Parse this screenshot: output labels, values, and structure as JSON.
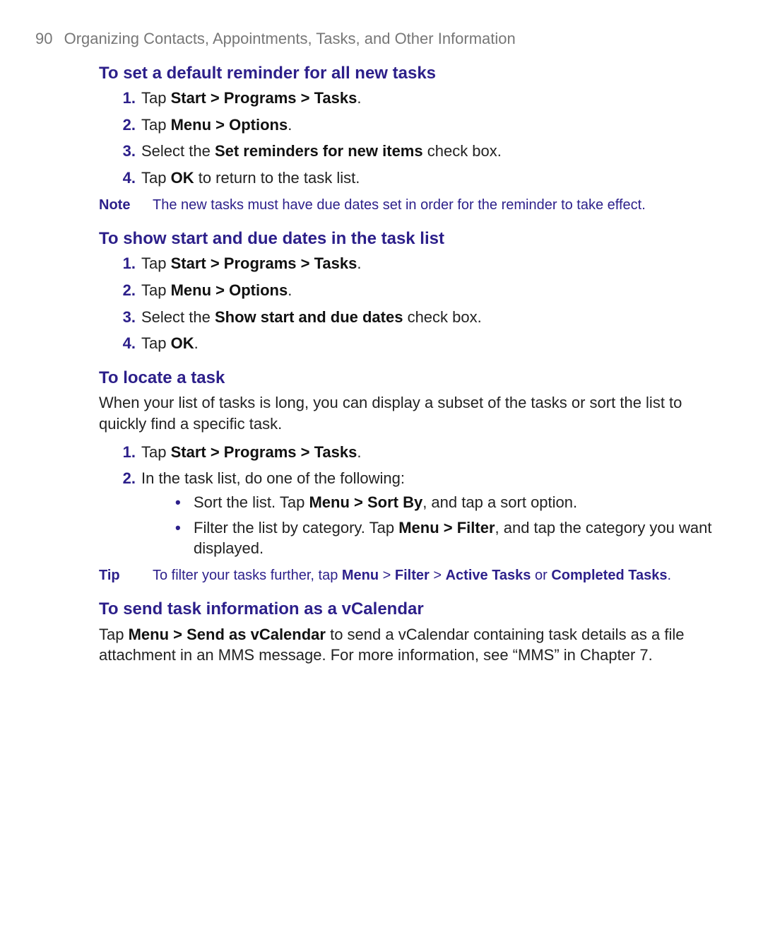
{
  "header": {
    "page_number": "90",
    "chapter_title": "Organizing Contacts, Appointments, Tasks, and Other Information"
  },
  "sec1": {
    "title": "To set a default reminder for all new tasks",
    "steps": {
      "m1": "1.",
      "s1a": "Tap ",
      "s1b": "Start > Programs > Tasks",
      "s1c": ".",
      "m2": "2.",
      "s2a": "Tap ",
      "s2b": "Menu > Options",
      "s2c": ".",
      "m3": "3.",
      "s3a": "Select the ",
      "s3b": "Set reminders for new items",
      "s3c": " check box.",
      "m4": "4.",
      "s4a": "Tap ",
      "s4b": "OK",
      "s4c": " to return to the task list."
    },
    "note": {
      "label": "Note",
      "text": "The new tasks must have due dates set in order for the reminder to take effect."
    }
  },
  "sec2": {
    "title": "To show start and due dates in the task list",
    "steps": {
      "m1": "1.",
      "s1a": "Tap ",
      "s1b": "Start > Programs > Tasks",
      "s1c": ".",
      "m2": "2.",
      "s2a": "Tap ",
      "s2b": "Menu > Options",
      "s2c": ".",
      "m3": "3.",
      "s3a": "Select the ",
      "s3b": "Show start and due dates",
      "s3c": " check box.",
      "m4": "4.",
      "s4a": "Tap ",
      "s4b": "OK",
      "s4c": "."
    }
  },
  "sec3": {
    "title": "To locate a task",
    "intro": "When your list of tasks is long, you can display a subset of the tasks or sort the list to quickly find a specific task.",
    "steps": {
      "m1": "1.",
      "s1a": "Tap ",
      "s1b": "Start > Programs > Tasks",
      "s1c": ".",
      "m2": "2.",
      "s2": "In the task list, do one of the following:"
    },
    "bullets": {
      "b1a": "Sort the list. Tap ",
      "b1b": "Menu > Sort By",
      "b1c": ", and tap a sort option.",
      "b2a": "Filter the list by category. Tap ",
      "b2b": "Menu > Filter",
      "b2c": ", and tap the category you want displayed."
    },
    "tip": {
      "label": "Tip",
      "t1": "To filter your tasks further, tap ",
      "t2": "Menu",
      "t3": " > ",
      "t4": "Filter",
      "t5": " > ",
      "t6": "Active Tasks",
      "t7": " or ",
      "t8": "Completed Tasks",
      "t9": "."
    }
  },
  "sec4": {
    "title": "To send task information as a vCalendar",
    "p1a": "Tap ",
    "p1b": "Menu > Send as vCalendar",
    "p1c": " to send a vCalendar containing task details as a file attachment in an MMS message. For more information, see “MMS” in Chapter 7."
  }
}
